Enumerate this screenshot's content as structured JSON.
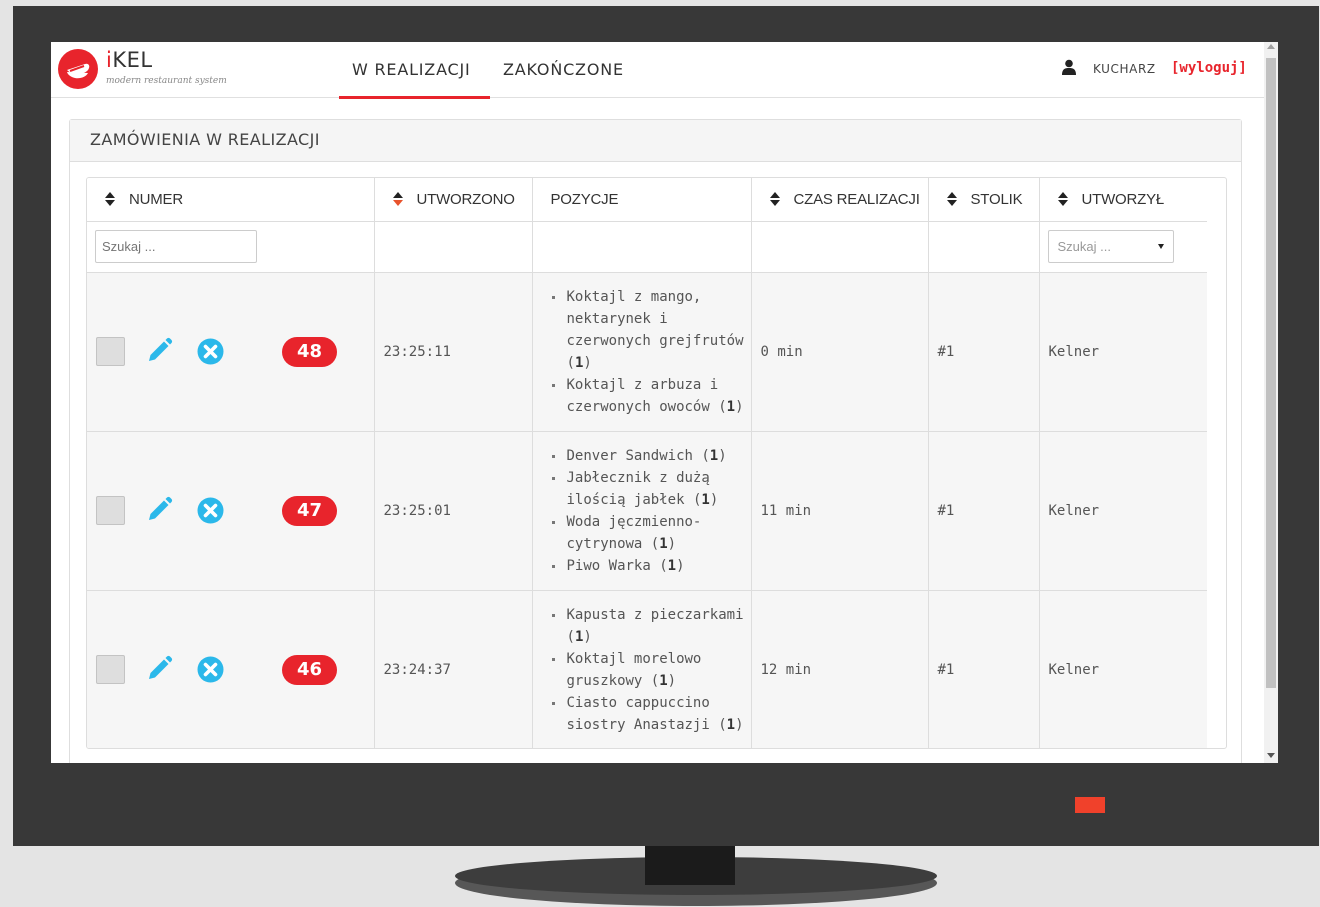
{
  "brand": {
    "name_prefix": "i",
    "name_rest": "KEL",
    "subtitle": "modern restaurant system"
  },
  "nav": {
    "tab_active": "W REALIZACJI",
    "tab_finished": "ZAKOŃCZONE"
  },
  "user": {
    "role": "KUCHARZ",
    "logout": "[wyloguj]"
  },
  "panel": {
    "title": "ZAMÓWIENIA W REALIZACJI"
  },
  "table": {
    "headers": {
      "number": "NUMER",
      "created": "UTWORZONO",
      "positions": "POZYCJE",
      "time": "CZAS REALIZACJI",
      "table": "STOLIK",
      "created_by": "UTWORZYŁ"
    },
    "filters": {
      "number_placeholder": "Szukaj ...",
      "created_by_selected": "Szukaj ..."
    },
    "rows": [
      {
        "number": "48",
        "created": "23:25:11",
        "items": [
          {
            "name": "Koktajl z mango, nektarynek i czerwonych grejfrutów",
            "qty": "1"
          },
          {
            "name": "Koktajl z arbuza i czerwonych owoców",
            "qty": "1"
          }
        ],
        "time": "0 min",
        "table": "#1",
        "created_by": "Kelner"
      },
      {
        "number": "47",
        "created": "23:25:01",
        "items": [
          {
            "name": "Denver Sandwich",
            "qty": "1"
          },
          {
            "name": "Jabłecznik z dużą ilością jabłek",
            "qty": "1"
          },
          {
            "name": "Woda jęczmienno-cytrynowa",
            "qty": "1"
          },
          {
            "name": "Piwo Warka",
            "qty": "1"
          }
        ],
        "time": "11 min",
        "table": "#1",
        "created_by": "Kelner"
      },
      {
        "number": "46",
        "created": "23:24:37",
        "items": [
          {
            "name": "Kapusta z pieczarkami",
            "qty": "1"
          },
          {
            "name": "Koktajl morelowo gruszkowy",
            "qty": "1"
          },
          {
            "name": "Ciasto cappuccino siostry Anastazji",
            "qty": "1"
          }
        ],
        "time": "12 min",
        "table": "#1",
        "created_by": "Kelner"
      }
    ]
  },
  "colors": {
    "accent": "#e8242c",
    "info_icon": "#2bb8ea"
  }
}
